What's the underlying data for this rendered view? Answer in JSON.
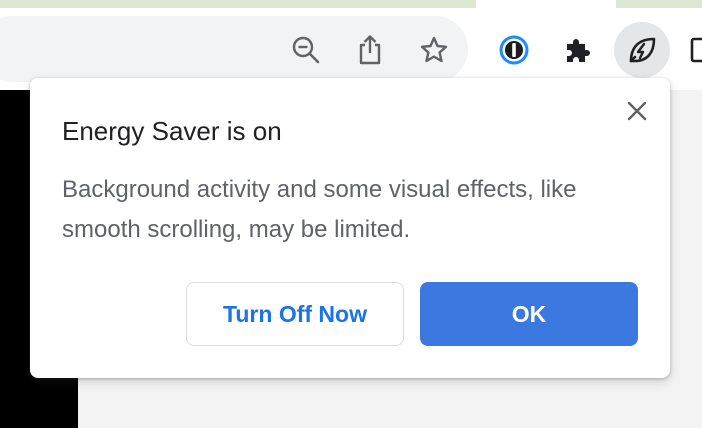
{
  "toolbar": {
    "icons": [
      "zoom-out-icon",
      "share-icon",
      "bookmark-star-icon",
      "password-manager-icon",
      "extensions-puzzle-icon",
      "energy-saver-leaf-icon",
      "side-panel-icon"
    ]
  },
  "bubble": {
    "title": "Energy Saver is on",
    "body": "Background activity and some visual effects, like smooth scrolling, may be limited.",
    "secondary_button": "Turn Off Now",
    "primary_button": "OK",
    "close_icon": "close-icon"
  },
  "colors": {
    "primary_button_bg": "#3b78e0",
    "secondary_button_text": "#1a73e8",
    "tab_strip": "#dce8d2"
  }
}
